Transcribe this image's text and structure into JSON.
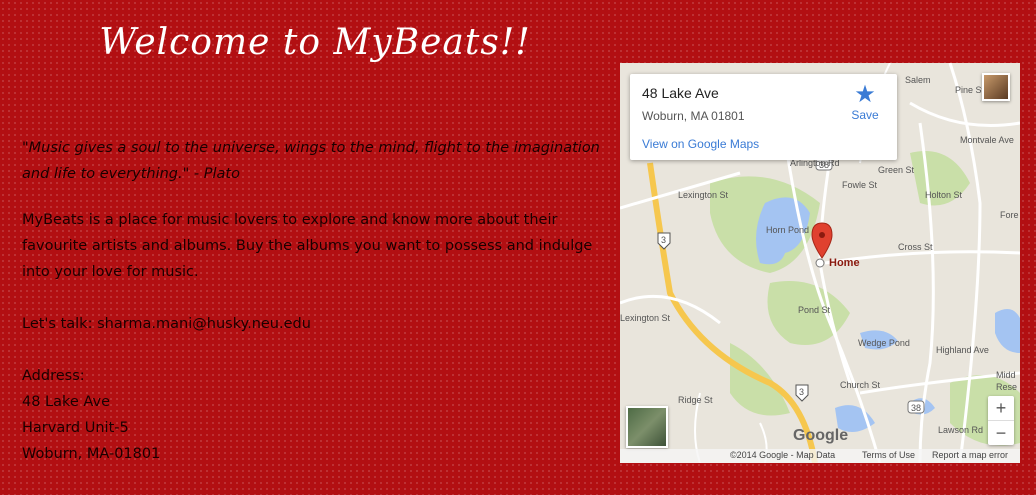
{
  "page": {
    "title": "Welcome  to  MyBeats!!",
    "quote": "\"Music gives a soul to the universe, wings to the mind, flight to the imagination and life to everything.\" - Plato",
    "intro": "MyBeats is a place for music lovers to explore and know more about their favourite artists and albums. Buy the albums you want to possess and indulge into your love for music.",
    "contact": "Let's talk: sharma.mani@husky.neu.edu",
    "address_label": "Address:",
    "address_line1": "48 Lake Ave",
    "address_line2": "Harvard Unit-5",
    "address_line3": "Woburn, MA-01801"
  },
  "map": {
    "card_title": "48 Lake Ave",
    "card_address": "Woburn, MA 01801",
    "save_label": "Save",
    "view_link": "View on Google Maps",
    "marker_label": "Home",
    "logo": "Google",
    "footer_copyright": "©2014 Google - Map Data",
    "footer_terms": "Terms of Use",
    "footer_report": "Report a map error",
    "zoom_in": "+",
    "zoom_out": "−",
    "labels": {
      "salem": "Salem",
      "pine": "Pine St",
      "montvale": "Montvale Ave",
      "fowle": "Fowle St",
      "green": "Green St",
      "holton": "Holton St",
      "cross": "Cross St",
      "fore": "Fore",
      "arlington": "Arlington Rd",
      "lexington1": "Lexington St",
      "lexington2": "Lexington St",
      "hornpond": "Horn Pond",
      "wedgepond": "Wedge Pond",
      "pond": "Pond St",
      "church": "Church St",
      "highland": "Highland Ave",
      "ridge": "Ridge St",
      "lawson": "Lawson Rd",
      "midd": "Midd",
      "rese": "Rese",
      "route38a": "38",
      "route38b": "38",
      "route3a": "3",
      "route3b": "3"
    }
  },
  "colors": {
    "background": "#b20f12",
    "title": "#ffffff",
    "link": "#3a7bd5",
    "marker": "#e0412f",
    "highway": "#f6c74e",
    "water": "#a4c4f2",
    "park": "#c9dfa8"
  }
}
